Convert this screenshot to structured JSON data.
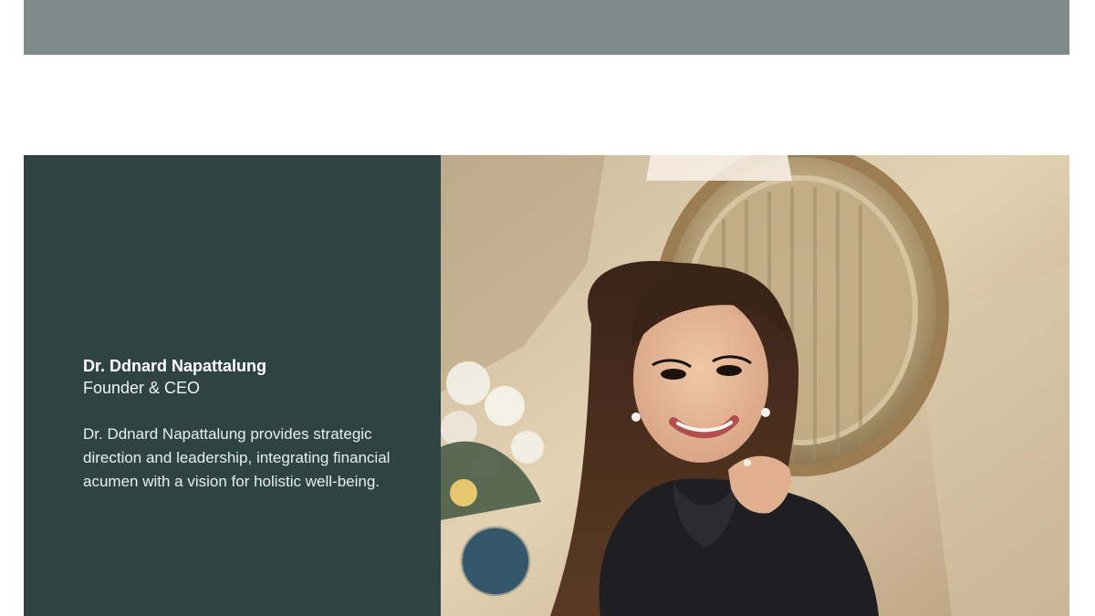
{
  "profile": {
    "name": "Dr. Ddnard Napattalung",
    "role": "Founder & CEO",
    "bio": "Dr. Ddnard Napattalung provides strategic direction and leadership, integrating financial acumen with a vision for holistic well-being."
  },
  "colors": {
    "banner": "#7f8b8b",
    "panel": "#2f4343",
    "text": "#ffffff"
  }
}
